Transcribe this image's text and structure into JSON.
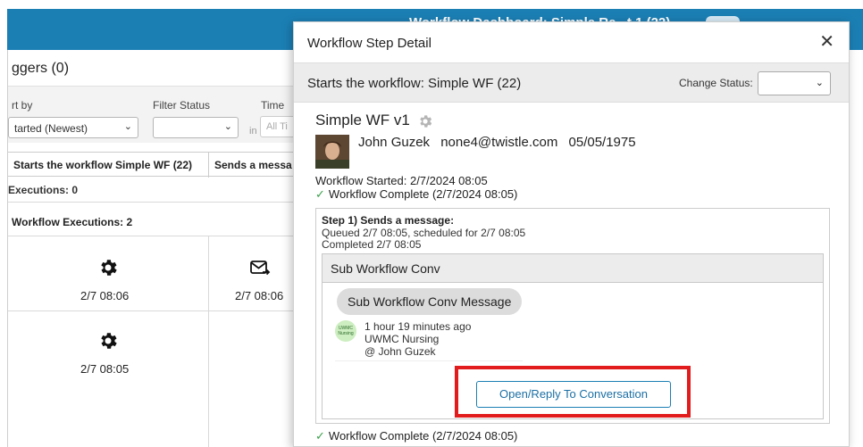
{
  "app": {
    "topbar_title": "Workflow Dashboard: Simple Re...t 1 (22)",
    "page_heading": "ggers (0)"
  },
  "toolbar": {
    "sort_label": "rt by",
    "sort_value": "tarted (Newest)",
    "filter_status_label": "Filter Status",
    "filter_status_value": "",
    "time_label": "Time",
    "in_label": "in",
    "time_value": "All Ti"
  },
  "table": {
    "col1_header": "Starts the workflow Simple WF (22)",
    "col2_header": "Sends a messa",
    "executions_line": "Executions: 0",
    "workflow_executions_line": "Workflow Executions: 2",
    "cells": [
      {
        "icon": "gear-icon",
        "time": "2/7 08:06"
      },
      {
        "icon": "message-send-icon",
        "time": "2/7 08:06"
      },
      {
        "icon": "gear-icon",
        "time": "2/7 08:05"
      }
    ]
  },
  "modal": {
    "title": "Workflow Step Detail",
    "close_glyph": "✕",
    "subheader_title": "Starts the workflow: Simple WF (22)",
    "change_status_label": "Change Status:",
    "change_status_value": "",
    "workflow_name": "Simple WF v1",
    "user": {
      "name": "John Guzek",
      "email": "none4@twistle.com",
      "dob": "05/05/1975"
    },
    "workflow_started": "Workflow Started: 2/7/2024 08:05",
    "workflow_complete_top": "Workflow Complete (2/7/2024 08:05)",
    "step": {
      "title": "Step 1) Sends a message:",
      "queued": "Queued 2/7 08:05, scheduled for 2/7 08:05",
      "completed": "Completed 2/7 08:05"
    },
    "conversation": {
      "title": "Sub Workflow Conv",
      "message": "Sub Workflow Conv Message",
      "org_badge": "UWMC Nursing",
      "time_ago": "1 hour 19 minutes ago",
      "sender": "UWMC Nursing",
      "recipient": "@ John Guzek",
      "open_button": "Open/Reply To Conversation"
    },
    "workflow_complete_bottom": "Workflow Complete (2/7/2024 08:05)"
  },
  "colors": {
    "topbar": "#1b7fb4",
    "check": "#3aa14b",
    "highlight": "#e21c1c"
  }
}
